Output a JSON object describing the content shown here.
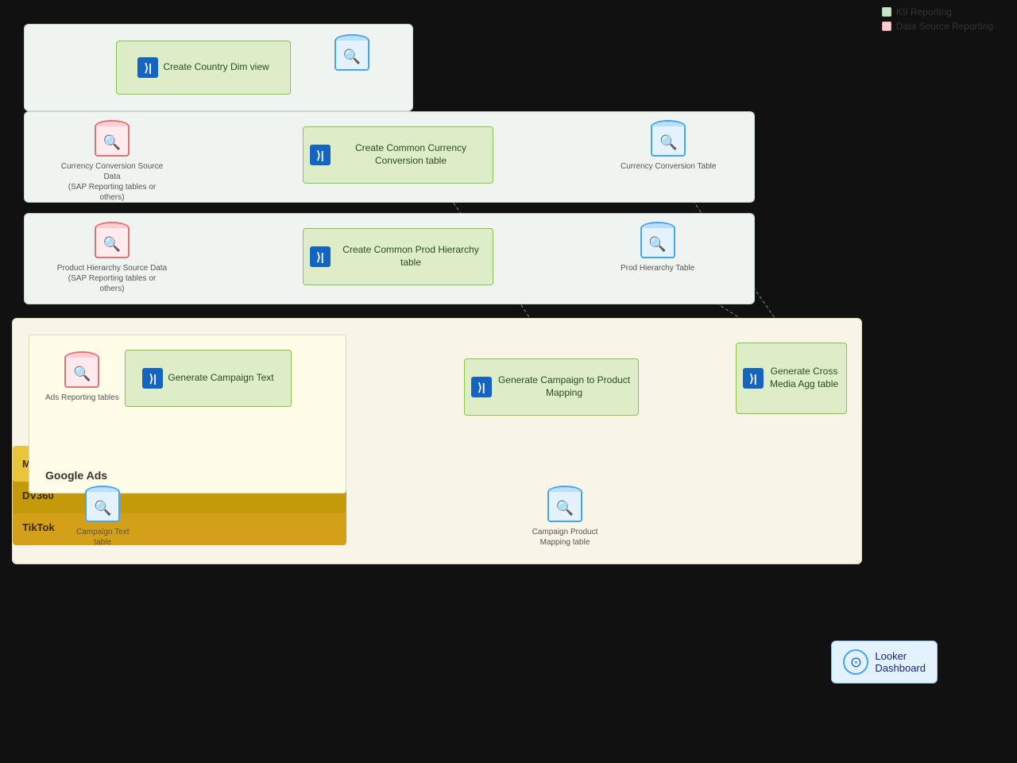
{
  "legend": {
    "k9": "K9 Reporting",
    "dataSource": "Data Source Reporting"
  },
  "sections": {
    "countryDim": {
      "label": ""
    },
    "currency": {
      "label": ""
    },
    "prodHierarchy": {
      "label": ""
    },
    "campaigns": {
      "label": ""
    }
  },
  "nodes": {
    "createCountryDim": "Create Country Dim view",
    "createCurrencyConversion": "Create Common Currency Conversion table",
    "createProdHierarchy": "Create Common Prod Hierarchy table",
    "generateCampaignText": "Generate Campaign Text",
    "generateCampaignMapping": "Generate Campaign to Product Mapping",
    "generateCrossMedia": "Generate Cross Media Agg table"
  },
  "databases": {
    "currencySource": "Currency Conversion Source Data\n(SAP Reporting tables or others)",
    "currencyTarget": "Currency Conversion Table",
    "prodSource": "Product Hierarchy Source Data\n(SAP Reporting tables or others)",
    "prodTarget": "Prod Hierarchy Table",
    "adsReporting": "Ads Reporting tables",
    "campaignText": "Campaign Text\ntable",
    "campaignMapping": "Campaign Product\nMapping table",
    "countryDimDb": ""
  },
  "platforms": {
    "googleAds": "Google Ads",
    "meta": "Meta",
    "dv360": "DV360",
    "tiktok": "TikTok"
  },
  "looker": {
    "label": "Looker\nDashboard"
  }
}
